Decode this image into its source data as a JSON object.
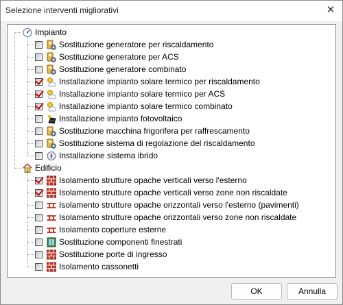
{
  "window": {
    "title": "Selezione interventi migliorativi"
  },
  "tree": {
    "groups": [
      {
        "label": "Impianto",
        "items": [
          {
            "label": "Sostituzione generatore per riscaldamento",
            "checked": false,
            "icon": "gear-device-icon"
          },
          {
            "label": "Sostituzione generatore per ACS",
            "checked": false,
            "icon": "gear-device-icon"
          },
          {
            "label": "Sostituzione generatore combinato",
            "checked": false,
            "icon": "gear-device-icon"
          },
          {
            "label": "Installazione impianto solare termico per riscaldamento",
            "checked": true,
            "icon": "sun-cloud-icon"
          },
          {
            "label": "Installazione impianto solare termico per ACS",
            "checked": true,
            "icon": "sun-cloud-icon"
          },
          {
            "label": "Installazione impianto solare termico combinato",
            "checked": true,
            "icon": "sun-cloud-icon"
          },
          {
            "label": "Installazione impianto fotovoltaico",
            "checked": false,
            "icon": "solar-panel-icon"
          },
          {
            "label": "Sostituzione macchina frigorifera per raffrescamento",
            "checked": false,
            "icon": "gear-device-icon"
          },
          {
            "label": "Sostituzione sistema di regolazione del riscaldamento",
            "checked": false,
            "icon": "gear-device-icon"
          },
          {
            "label": "Installazione sistema ibrido",
            "checked": false,
            "icon": "compass-icon"
          }
        ]
      },
      {
        "label": "Edificio",
        "items": [
          {
            "label": "Isolamento strutture opache verticali verso l'esterno",
            "checked": true,
            "icon": "brick-wall-icon"
          },
          {
            "label": "Isolamento strutture opache verticali verso zone non riscaldate",
            "checked": true,
            "icon": "brick-wall-icon"
          },
          {
            "label": "Isolamento strutture opache orizzontali verso l'esterno (pavimenti)",
            "checked": false,
            "icon": "floor-slab-icon"
          },
          {
            "label": "Isolamento strutture opache orizzontali verso zone non riscaldate",
            "checked": false,
            "icon": "floor-slab-icon"
          },
          {
            "label": "Isolamento coperture esterne",
            "checked": false,
            "icon": "floor-slab-icon"
          },
          {
            "label": "Sostituzione componenti finestrati",
            "checked": false,
            "icon": "window-icon"
          },
          {
            "label": "Sostituzione porte di ingresso",
            "checked": false,
            "icon": "brick-wall-icon"
          },
          {
            "label": "Isolamento cassonetti",
            "checked": false,
            "icon": "brick-wall-icon"
          }
        ]
      }
    ]
  },
  "buttons": {
    "ok": "OK",
    "cancel": "Annulla"
  },
  "colors": {
    "check": "#cc0000",
    "tree_border": "#828790",
    "dialog_bg": "#f0f0f0"
  }
}
